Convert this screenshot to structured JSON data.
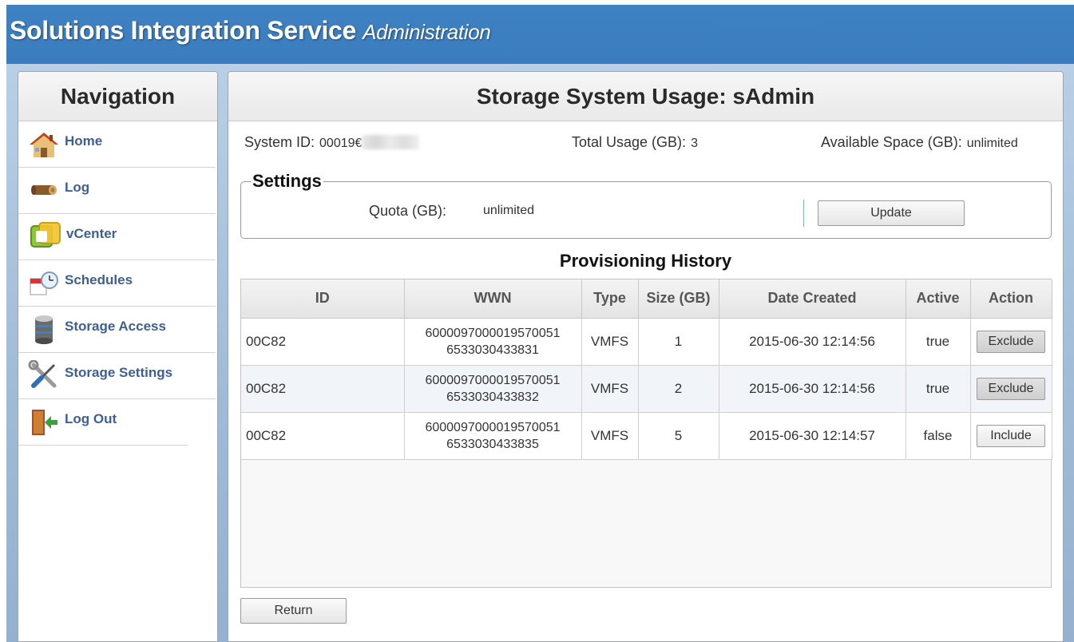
{
  "app": {
    "title": "Solutions Integration Service",
    "subtitle": "Administration"
  },
  "nav": {
    "heading": "Navigation",
    "items": [
      {
        "label": "Home",
        "icon": "house-icon"
      },
      {
        "label": "Log",
        "icon": "wood-log-icon"
      },
      {
        "label": "vCenter",
        "icon": "vcenter-icon"
      },
      {
        "label": "Schedules",
        "icon": "calendar-clock-icon"
      },
      {
        "label": "Storage Access",
        "icon": "storage-cylinder-icon"
      },
      {
        "label": "Storage Settings",
        "icon": "wrench-screwdriver-icon"
      },
      {
        "label": "Log Out",
        "icon": "door-exit-icon"
      }
    ]
  },
  "main": {
    "heading": "Storage System Usage: sAdmin",
    "system_id_label": "System ID:",
    "system_id_value": "00019€",
    "total_usage_label": "Total Usage (GB):",
    "total_usage_value": "3",
    "available_label": "Available Space (GB):",
    "available_value": "unlimited",
    "settings": {
      "legend": "Settings",
      "quota_label": "Quota (GB):",
      "quota_value": "unlimited",
      "update_label": "Update"
    },
    "history_title": "Provisioning History",
    "columns": [
      "ID",
      "WWN",
      "Type",
      "Size (GB)",
      "Date Created",
      "Active",
      "Action"
    ],
    "rows": [
      {
        "id": "00C82",
        "wwn1": "6000097000019570051",
        "wwn2": "6533030433831",
        "type": "VMFS",
        "size": "1",
        "date": "2015-06-30 12:14:56",
        "active": "true",
        "action": "Exclude"
      },
      {
        "id": "00C82",
        "wwn1": "6000097000019570051",
        "wwn2": "6533030433832",
        "type": "VMFS",
        "size": "2",
        "date": "2015-06-30 12:14:56",
        "active": "true",
        "action": "Exclude"
      },
      {
        "id": "00C82",
        "wwn1": "6000097000019570051",
        "wwn2": "6533030433835",
        "type": "VMFS",
        "size": "5",
        "date": "2015-06-30 12:14:57",
        "active": "false",
        "action": "Include"
      }
    ],
    "return_label": "Return"
  },
  "colors": {
    "header_blue": "#3f82c4",
    "nav_link": "#3e5f95",
    "background_blue": "#a9c3de"
  }
}
